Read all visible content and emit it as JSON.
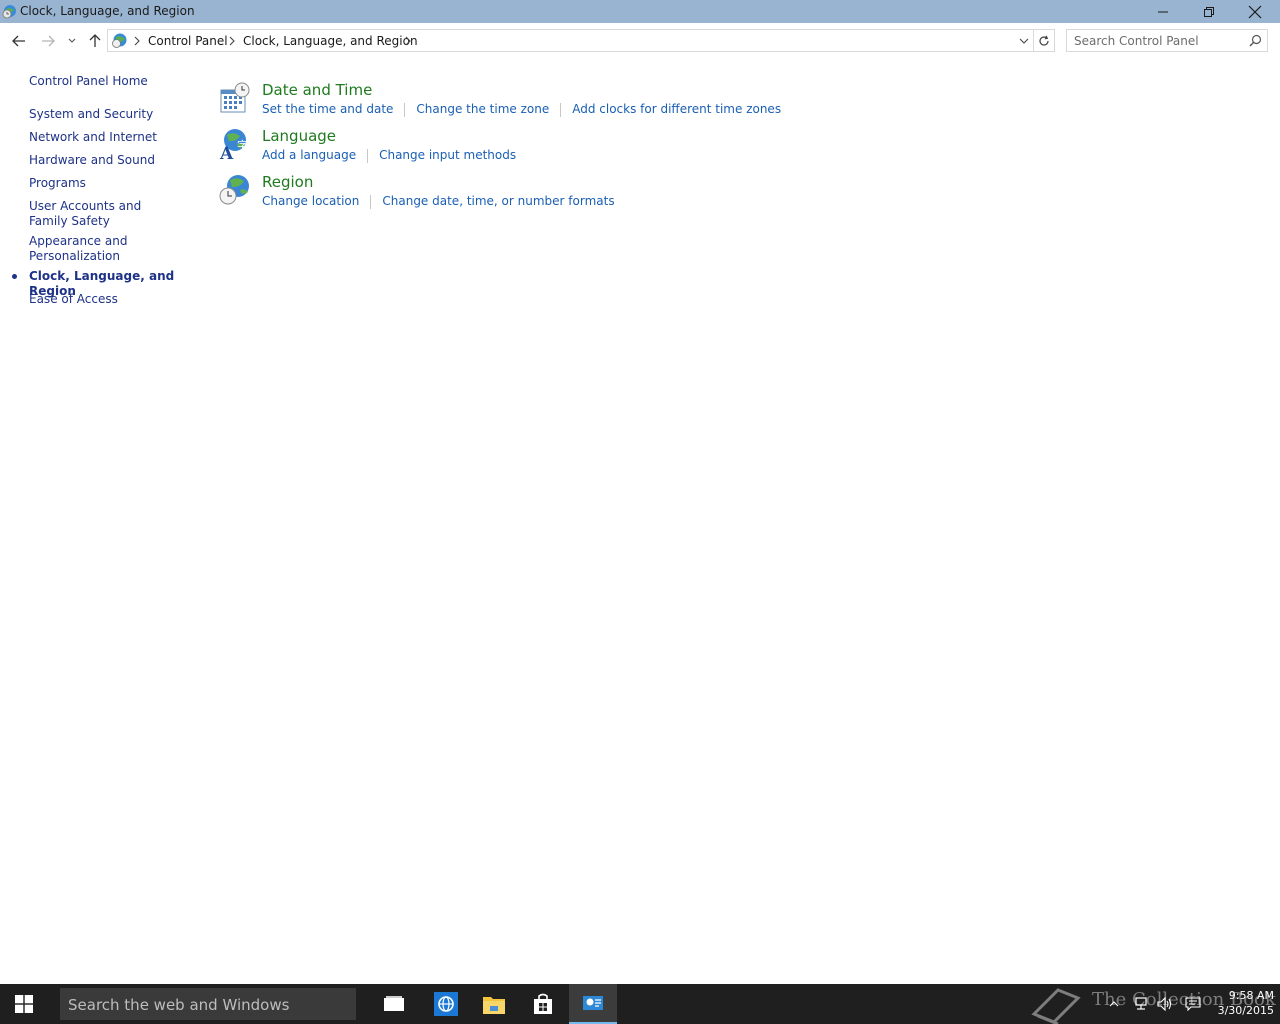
{
  "window": {
    "title": "Clock, Language, and Region",
    "controls": [
      "minimize",
      "restore",
      "close"
    ]
  },
  "address": {
    "breadcrumbs": [
      "Control Panel",
      "Clock, Language, and Region"
    ],
    "search_placeholder": "Search Control Panel"
  },
  "sidebar": {
    "home": "Control Panel Home",
    "items": [
      {
        "label": "System and Security"
      },
      {
        "label": "Network and Internet"
      },
      {
        "label": "Hardware and Sound"
      },
      {
        "label": "Programs"
      },
      {
        "label": "User Accounts and Family Safety"
      },
      {
        "label": "Appearance and Personalization"
      },
      {
        "label": "Clock, Language, and Region",
        "current": true
      },
      {
        "label": "Ease of Access"
      }
    ]
  },
  "categories": [
    {
      "title": "Date and Time",
      "icon": "calendar-clock-icon",
      "links": [
        "Set the time and date",
        "Change the time zone",
        "Add clocks for different time zones"
      ]
    },
    {
      "title": "Language",
      "icon": "language-globe-icon",
      "links": [
        "Add a language",
        "Change input methods"
      ]
    },
    {
      "title": "Region",
      "icon": "region-globe-clock-icon",
      "links": [
        "Change location",
        "Change date, time, or number formats"
      ]
    }
  ],
  "taskbar": {
    "search_placeholder": "Search the web and Windows",
    "apps": [
      "task-view",
      "internet-explorer",
      "file-explorer",
      "store",
      "control-panel"
    ],
    "watermark": "The Collection Book",
    "time": "9:58 AM",
    "date": "3/30/2015"
  },
  "colors": {
    "titlebar": "#99b4d1",
    "heading_green": "#1e7b1e",
    "link_blue": "#1a5fb4",
    "nav_blue": "#1e3287",
    "taskbar": "#1f1f1f"
  }
}
